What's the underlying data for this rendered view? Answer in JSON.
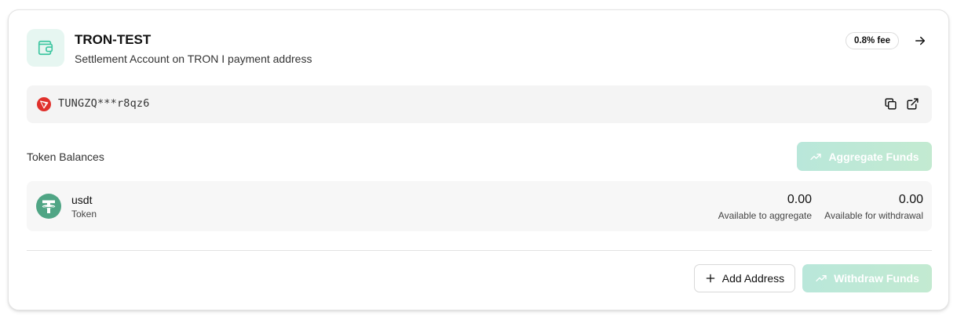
{
  "account": {
    "title": "TRON-TEST",
    "subtitle": "Settlement Account on TRON I payment address",
    "fee_badge": "0.8% fee",
    "icon": "wallet-icon",
    "accent_color": "#3cc6a0"
  },
  "address": {
    "network_icon": "tron-logo",
    "value": "TUNGZQ***r8qz6",
    "actions": [
      "copy-icon",
      "external-link-icon"
    ]
  },
  "balances": {
    "section_label": "Token Balances",
    "aggregate_button": "Aggregate Funds",
    "tokens": [
      {
        "symbol": "usdt",
        "type": "Token",
        "icon": "tether-logo",
        "available_to_aggregate": "0.00",
        "available_to_aggregate_label": "Available to aggregate",
        "available_for_withdrawal": "0.00",
        "available_for_withdrawal_label": "Available for withdrawal"
      }
    ]
  },
  "footer": {
    "add_address_button": "Add Address",
    "withdraw_button": "Withdraw Funds"
  }
}
